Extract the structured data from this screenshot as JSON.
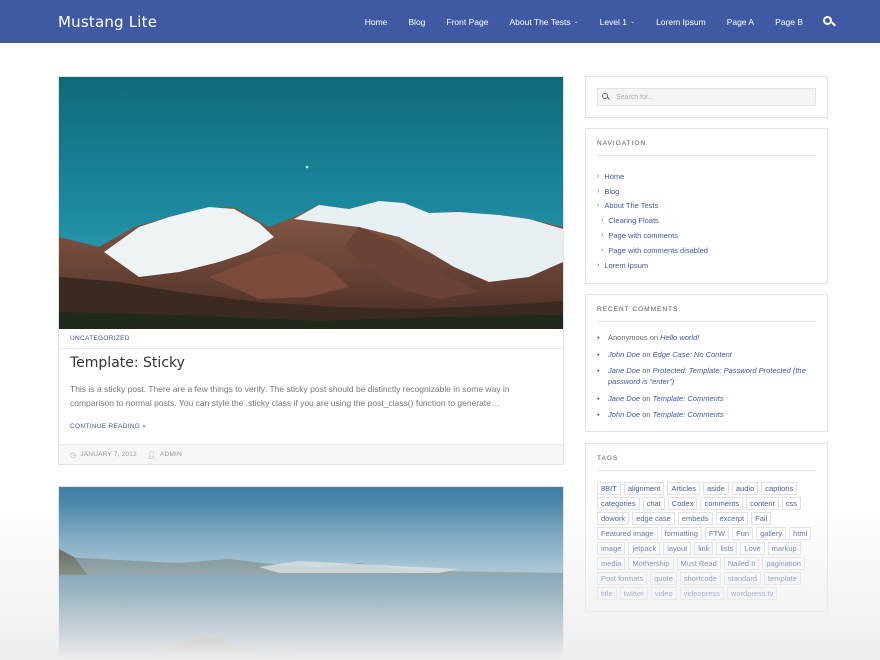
{
  "header": {
    "logo": "Mustang Lite",
    "nav": [
      {
        "label": "Home",
        "dropdown": false
      },
      {
        "label": "Blog",
        "dropdown": false
      },
      {
        "label": "Front Page",
        "dropdown": false
      },
      {
        "label": "About The Tests",
        "dropdown": true
      },
      {
        "label": "Level 1",
        "dropdown": true
      },
      {
        "label": "Lorem Ipsum",
        "dropdown": false
      },
      {
        "label": "Page A",
        "dropdown": false
      },
      {
        "label": "Page B",
        "dropdown": false
      }
    ],
    "search_icon": "search-icon",
    "background_color": "#3f5aa3"
  },
  "post": {
    "category": "UNCATEGORIZED",
    "title": "Template: Sticky",
    "excerpt": "This is a sticky post. There are a few things to verify: The sticky post should be distinctly recognizable in some way in comparison to normal posts. You can style the .sticky class if you are using the post_class() function to generate…",
    "read_more": "CONTINUE READING »",
    "date": "JANUARY 7, 2012",
    "author": "ADMIN",
    "date_icon": "clock-icon",
    "author_icon": "user-icon"
  },
  "sidebar": {
    "search": {
      "placeholder": "Search for..."
    },
    "navigation": {
      "title": "NAVIGATION",
      "items": [
        {
          "label": "Home",
          "sub": false
        },
        {
          "label": "Blog",
          "sub": false
        },
        {
          "label": "About The Tests",
          "sub": false
        },
        {
          "label": "Clearing Floats",
          "sub": true
        },
        {
          "label": "Page with comments",
          "sub": true
        },
        {
          "label": "Page with comments disabled",
          "sub": true
        },
        {
          "label": "Lorem Ipsum",
          "sub": false
        }
      ]
    },
    "recent_comments": {
      "title": "RECENT COMMENTS",
      "connector": "on",
      "items": [
        {
          "author": "Anonymous",
          "author_link": false,
          "post": "Hello world!"
        },
        {
          "author": "John Doe",
          "author_link": true,
          "post": "Edge Case: No Content"
        },
        {
          "author": "Jane Doe",
          "author_link": true,
          "post": "Protected: Template: Password Protected (the password is “enter”)"
        },
        {
          "author": "Jane Doe",
          "author_link": true,
          "post": "Template: Comments"
        },
        {
          "author": "John Doe",
          "author_link": true,
          "post": "Template: Comments"
        }
      ]
    },
    "tags": {
      "title": "TAGS",
      "items": [
        "8BIT",
        "alignment",
        "Articles",
        "aside",
        "audio",
        "captions",
        "categories",
        "chat",
        "Codex",
        "comments",
        "content",
        "css",
        "dowork",
        "edge case",
        "embeds",
        "excerpt",
        "Fail",
        "Featured image",
        "formatting",
        "FTW",
        "Fun",
        "gallery",
        "html",
        "image",
        "jetpack",
        "layout",
        "link",
        "lists",
        "Love",
        "markup",
        "media",
        "Mothership",
        "Must Read",
        "Nailed It",
        "pagination",
        "Post formats",
        "quote",
        "shortcode",
        "standard",
        "template",
        "title",
        "twitter",
        "video",
        "videopress",
        "wordpress.tv"
      ]
    }
  }
}
